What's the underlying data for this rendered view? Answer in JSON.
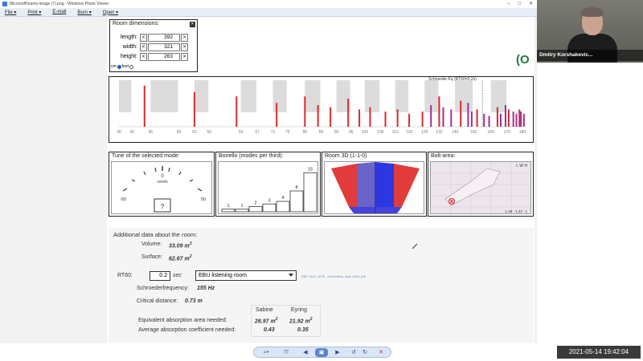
{
  "window": {
    "title": "MicrosoftTeams-image (7).png - Windows Photo Viewer",
    "minimize": "–",
    "maximize": "□",
    "close": "✕"
  },
  "menu": [
    "File ▾",
    "Print ▾",
    "E-mail",
    "Burn ▾",
    "Open ▾"
  ],
  "room_dimensions": {
    "title": "Room dimensions:",
    "close": "✕",
    "rows": [
      {
        "label": "length:",
        "value": "392"
      },
      {
        "label": "width:",
        "value": "321"
      },
      {
        "label": "height:",
        "value": "263"
      }
    ],
    "minus": "<",
    "plus": ">",
    "unit_cm": "cm",
    "unit_feet": "feet"
  },
  "logo_text": "(O",
  "mode_chart": {
    "schroeder_label": "Schroeder-Fq (RT60=0.2s)",
    "x_ticks": [
      "40",
      "42",
      "45",
      "50",
      "53",
      "56",
      "63",
      "67",
      "71",
      "75",
      "80",
      "85",
      "90",
      "95",
      "100",
      "106",
      "112",
      "118",
      "125",
      "132",
      "140",
      "150",
      "160",
      "170",
      "180"
    ]
  },
  "chart_data": {
    "type": "bar",
    "title": "",
    "xlabel": "",
    "ylabel": "",
    "x_ticks": [
      40,
      42,
      45,
      50,
      53,
      56,
      63,
      67,
      71,
      75,
      80,
      85,
      90,
      95,
      100,
      106,
      112,
      118,
      125,
      132,
      140,
      150,
      160,
      170,
      180
    ],
    "series": [
      {
        "name": "",
        "x": [
          44,
          53,
          62,
          72,
          80,
          84,
          88,
          94,
          98,
          102,
          108,
          113,
          118,
          124,
          128,
          132,
          134,
          138,
          143,
          147,
          149,
          152,
          156,
          159,
          164,
          166,
          169,
          171,
          174,
          176,
          178,
          179,
          181
        ],
        "values": [
          0.95,
          0.8,
          0.7,
          0.55,
          0.7,
          0.5,
          0.45,
          0.65,
          0.4,
          0.45,
          0.35,
          0.4,
          0.3,
          0.35,
          0.5,
          0.7,
          0.45,
          0.4,
          0.6,
          0.55,
          0.35,
          0.4,
          0.3,
          0.25,
          0.45,
          0.3,
          0.5,
          0.4,
          0.35,
          0.3,
          0.4,
          0.35,
          0.3
        ]
      }
    ],
    "schroeder_frequency": 155
  },
  "panels": {
    "tune": {
      "title": "Tune of the selected mode:",
      "center": "0",
      "unit": "cents",
      "left": "-50",
      "right": "50",
      "value": "?"
    },
    "bonello": {
      "title": "Bonello (modes per third):",
      "values": [
        1,
        1,
        2,
        3,
        4,
        8,
        15
      ],
      "labels": [
        "1",
        "1",
        "2",
        "3",
        "4",
        "8",
        "15"
      ]
    },
    "room3d": {
      "title": "Room 3D (1-1-0)"
    },
    "bolt": {
      "title": "Bolt-area:",
      "corner": "L W H",
      "coords": "1.48 : 1.22 : 1"
    }
  },
  "additional": {
    "heading": "Additional data about the room:",
    "volume_label": "Volume:",
    "volume_value": "33.09 m",
    "volume_exp": "3",
    "surface_label": "Surface:",
    "surface_value": "62.67 m",
    "surface_exp": "2",
    "rt60_label": "RT60:",
    "rt60_value": "0.2",
    "rt60_unit": "sec",
    "room_type": "EBU listening room",
    "reference": "EBU Tech. 3276 - 2nd edition, May 1998, pdf",
    "schroeder_label": "Schroederfrequency:",
    "schroeder_value": "155 Hz",
    "critical_label": "Critical distance:",
    "critical_value": "0.73 m",
    "col_sabine": "Sabine",
    "col_eyring": "Eyring",
    "row1_label": "Equivalent absorption area needed:",
    "row1_sabine": "26.97 m",
    "row1_eyring": "21.92 m",
    "area_exp": "2",
    "row2_label": "Average absorption coefficient needed:",
    "row2_sabine": "0.43",
    "row2_eyring": "0.35"
  },
  "toolbar": {
    "zoom": "⌕▾",
    "fit": "⤧",
    "prev": "◀",
    "slideshow": "▣",
    "next": "▶",
    "rotate_left": "↺",
    "rotate_right": "↻",
    "delete": "✕"
  },
  "timestamp": "2021-05-14  19:42:04",
  "video": {
    "name": "Dmitry Korshakevic..."
  },
  "colors": {
    "red": "#d92b2b",
    "purple": "#a03090",
    "accent": "#1a5fd0"
  }
}
